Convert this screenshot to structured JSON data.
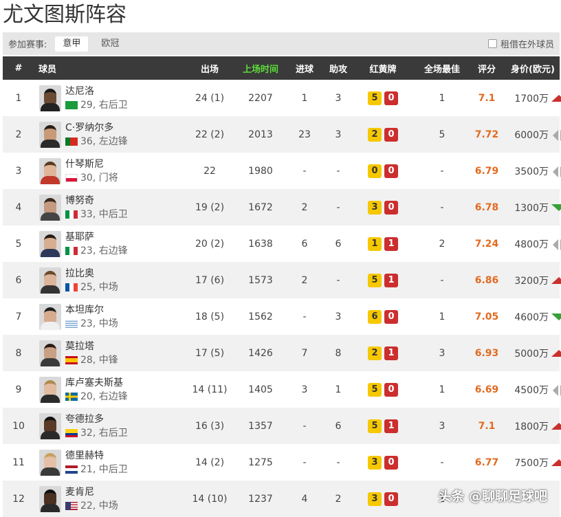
{
  "page": {
    "title": "尤文图斯阵容"
  },
  "filter": {
    "label": "参加赛事:",
    "tabs": [
      {
        "label": "意甲",
        "active": true
      },
      {
        "label": "欧冠",
        "active": false
      }
    ],
    "loan_label": "租借在外球员",
    "loan_checked": false
  },
  "table": {
    "headers": {
      "rank": "#",
      "player": "球员",
      "apps": "出场",
      "minutes": "上场时间",
      "goals": "进球",
      "assists": "助攻",
      "cards": "红黄牌",
      "mvp": "全场最佳",
      "rating": "评分",
      "value": "身价(欧元)"
    },
    "rows": [
      {
        "rank": "1",
        "name": "达尼洛",
        "flag": "br-flag",
        "age_pos": "29, 右后卫",
        "apps": "24 (1)",
        "minutes": "2207",
        "goals": "1",
        "assists": "3",
        "yellow": "5",
        "red": "0",
        "mvp": "1",
        "rating": "7.1",
        "value": "1700万",
        "trend": "up",
        "skin": "#6b4a34",
        "hair": "#1a1a1a",
        "kit": "#222222"
      },
      {
        "rank": "2",
        "name": "C·罗纳尔多",
        "flag": "pt-flag",
        "age_pos": "36, 左边锋",
        "apps": "22 (2)",
        "minutes": "2013",
        "goals": "23",
        "assists": "3",
        "yellow": "2",
        "red": "0",
        "mvp": "5",
        "rating": "7.72",
        "value": "6000万",
        "trend": "flat",
        "skin": "#c99a78",
        "hair": "#2a1e14",
        "kit": "#2a2a2a"
      },
      {
        "rank": "3",
        "name": "什琴斯尼",
        "flag": "pl-flag",
        "age_pos": "30, 门将",
        "apps": "22",
        "minutes": "1980",
        "goals": "-",
        "assists": "-",
        "yellow": "0",
        "red": "0",
        "mvp": "-",
        "rating": "6.79",
        "value": "3500万",
        "trend": "flat",
        "skin": "#e0b59a",
        "hair": "#5a3b22",
        "kit": "#c0392b"
      },
      {
        "rank": "4",
        "name": "博努奇",
        "flag": "it-flag",
        "age_pos": "33, 中后卫",
        "apps": "19 (2)",
        "minutes": "1672",
        "goals": "2",
        "assists": "-",
        "yellow": "3",
        "red": "0",
        "mvp": "-",
        "rating": "6.78",
        "value": "1300万",
        "trend": "down",
        "skin": "#c49a80",
        "hair": "#3a2a1e",
        "kit": "#444444"
      },
      {
        "rank": "5",
        "name": "基耶萨",
        "flag": "it-flag",
        "age_pos": "23, 右边锋",
        "apps": "20 (2)",
        "minutes": "1638",
        "goals": "6",
        "assists": "6",
        "yellow": "1",
        "red": "1",
        "mvp": "2",
        "rating": "7.24",
        "value": "4800万",
        "trend": "flat",
        "skin": "#d8ae90",
        "hair": "#2a1e14",
        "kit": "#2f3a5a"
      },
      {
        "rank": "6",
        "name": "拉比奥",
        "flag": "fr-flag",
        "age_pos": "25, 中场",
        "apps": "17 (6)",
        "minutes": "1573",
        "goals": "2",
        "assists": "-",
        "yellow": "5",
        "red": "1",
        "mvp": "-",
        "rating": "6.86",
        "value": "3200万",
        "trend": "up",
        "skin": "#dcb49a",
        "hair": "#6a4a2a",
        "kit": "#333333"
      },
      {
        "rank": "7",
        "name": "本坦库尔",
        "flag": "uy-flag",
        "age_pos": "23, 中场",
        "apps": "18 (5)",
        "minutes": "1562",
        "goals": "-",
        "assists": "3",
        "yellow": "6",
        "red": "0",
        "mvp": "1",
        "rating": "7.05",
        "value": "4600万",
        "trend": "down",
        "skin": "#d6ab8e",
        "hair": "#1e1e1e",
        "kit": "#f0f0f0"
      },
      {
        "rank": "8",
        "name": "莫拉塔",
        "flag": "es-flag",
        "age_pos": "28, 中锋",
        "apps": "17 (5)",
        "minutes": "1426",
        "goals": "7",
        "assists": "8",
        "yellow": "2",
        "red": "1",
        "mvp": "3",
        "rating": "6.93",
        "value": "5000万",
        "trend": "up",
        "skin": "#c8a084",
        "hair": "#2a1e14",
        "kit": "#3a3a3a"
      },
      {
        "rank": "9",
        "name": "库卢塞夫斯基",
        "flag": "se-flag",
        "age_pos": "20, 右边锋",
        "apps": "14 (11)",
        "minutes": "1405",
        "goals": "3",
        "assists": "1",
        "yellow": "5",
        "red": "0",
        "mvp": "1",
        "rating": "6.69",
        "value": "4500万",
        "trend": "flat",
        "skin": "#e2bca2",
        "hair": "#b08a50",
        "kit": "#2a2a2a"
      },
      {
        "rank": "10",
        "name": "夸德拉多",
        "flag": "co-flag",
        "age_pos": "32, 右后卫",
        "apps": "16 (3)",
        "minutes": "1357",
        "goals": "-",
        "assists": "6",
        "yellow": "5",
        "red": "1",
        "mvp": "3",
        "rating": "7.1",
        "value": "1800万",
        "trend": "up",
        "skin": "#5a3a26",
        "hair": "#111111",
        "kit": "#2a2a2a"
      },
      {
        "rank": "11",
        "name": "德里赫特",
        "flag": "nl-flag",
        "age_pos": "21, 中后卫",
        "apps": "14 (2)",
        "minutes": "1275",
        "goals": "-",
        "assists": "-",
        "yellow": "3",
        "red": "0",
        "mvp": "-",
        "rating": "6.77",
        "value": "7500万",
        "trend": "up",
        "skin": "#e4c0a6",
        "hair": "#c8a060",
        "kit": "#3a3a3a"
      },
      {
        "rank": "12",
        "name": "麦肯尼",
        "flag": "us-flag",
        "age_pos": "22, 中场",
        "apps": "14 (10)",
        "minutes": "1237",
        "goals": "4",
        "assists": "2",
        "yellow": "3",
        "red": "0",
        "mvp": "1",
        "rating": "",
        "value": "",
        "trend": "",
        "skin": "#4a3020",
        "hair": "#111111",
        "kit": "#2a2a2a"
      }
    ]
  },
  "watermark": "头条 @聊聊足球吧",
  "colors": {
    "header_bg": "#3a3a3a",
    "minutes_header": "#5ddc3a",
    "rating": "#e26a20",
    "yellow_card": "#f6c800",
    "red_card": "#cc2e2e",
    "trend_up": "#c9302c",
    "trend_down": "#36a136",
    "trend_flat": "#aaaaaa"
  }
}
